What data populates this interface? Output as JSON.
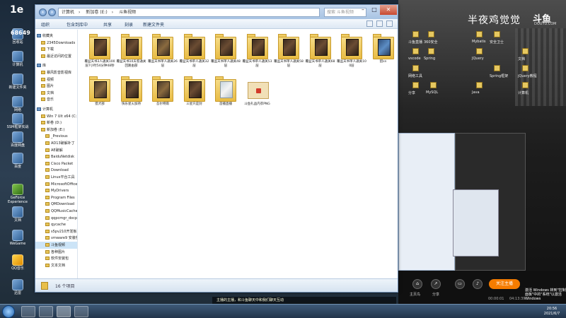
{
  "desktop": {
    "icons": [
      {
        "label": "回收站"
      },
      {
        "label": "计算机"
      },
      {
        "label": "新建文件夹"
      },
      {
        "label": "网络"
      },
      {
        "label": "SSM框架实战"
      },
      {
        "label": "百度网盘"
      },
      {
        "label": "百度"
      },
      {
        "label": "GeForce Experience"
      },
      {
        "label": "文档"
      },
      {
        "label": "WeGame"
      },
      {
        "label": "QQ音乐"
      },
      {
        "label": "迅雷"
      }
    ]
  },
  "overlay": {
    "brand": "1e",
    "viewer_count": "68649"
  },
  "explorer": {
    "address": [
      "计算机",
      "新加卷 (E:)",
      "斗鱼视频"
    ],
    "search_placeholder": "搜索 斗鱼视频",
    "toolbar": {
      "organize": "组织",
      "add_to_library": "包含到库中",
      "share": "共享",
      "burn": "刻录",
      "new_folder": "新建文件夹"
    },
    "sidebar": [
      {
        "label": "收藏夹",
        "type": "hdr"
      },
      {
        "label": "2345Downloads",
        "type": "item"
      },
      {
        "label": "下载",
        "type": "item"
      },
      {
        "label": "最近访问的位置",
        "type": "item"
      },
      {
        "label": "",
        "type": "gap"
      },
      {
        "label": "库",
        "type": "hdr"
      },
      {
        "label": "暴风影音影视库",
        "type": "item"
      },
      {
        "label": "视频",
        "type": "item"
      },
      {
        "label": "图片",
        "type": "item"
      },
      {
        "label": "文档",
        "type": "item"
      },
      {
        "label": "音乐",
        "type": "item"
      },
      {
        "label": "",
        "type": "gap"
      },
      {
        "label": "计算机",
        "type": "hdr"
      },
      {
        "label": "Win 7 Ult x64 (C:)",
        "type": "item"
      },
      {
        "label": "新卷 (D:)",
        "type": "item"
      },
      {
        "label": "新加卷 (E:)",
        "type": "item"
      },
      {
        "label": "_Previous",
        "type": "item"
      },
      {
        "label": "AD13破解补丁",
        "type": "item"
      },
      {
        "label": "AE破解",
        "type": "item"
      },
      {
        "label": "BaiduNetdisk",
        "type": "item"
      },
      {
        "label": "Cisco Packet",
        "type": "item"
      },
      {
        "label": "Download",
        "type": "item"
      },
      {
        "label": "Linux平台工具",
        "type": "item"
      },
      {
        "label": "MicrosoftOffice",
        "type": "item"
      },
      {
        "label": "MyDrivers",
        "type": "item"
      },
      {
        "label": "Program Files",
        "type": "item"
      },
      {
        "label": "QMDownload",
        "type": "item"
      },
      {
        "label": "QQMusicCache",
        "type": "item"
      },
      {
        "label": "qqpcmgr_docpro",
        "type": "item"
      },
      {
        "label": "qycache",
        "type": "item"
      },
      {
        "label": "s5pv210开发板",
        "type": "item"
      },
      {
        "label": "vmware9 安装包",
        "type": "item"
      },
      {
        "label": "斗鱼视频",
        "type": "sel"
      },
      {
        "label": "各种图片",
        "type": "item"
      },
      {
        "label": "软件安装包",
        "type": "item"
      },
      {
        "label": "文本文档",
        "type": "item"
      }
    ],
    "files": [
      {
        "label": "覆盆天书3人通关100层7小时54分钟48秒",
        "thumb": "dk"
      },
      {
        "label": "覆盆天书10天卷通关回路由部",
        "thumb": "dk"
      },
      {
        "label": "覆盆天书单人通关26层",
        "thumb": "bl"
      },
      {
        "label": "覆盆天书单人通关32层",
        "thumb": "dk"
      },
      {
        "label": "覆盆天书单人通关48层",
        "thumb": "dk"
      },
      {
        "label": "覆盆天书单人通关53层",
        "thumb": "dk"
      },
      {
        "label": "覆盆天书单人通关58层",
        "thumb": "dk"
      },
      {
        "label": "覆盆天书单人通关68层",
        "thumb": "dk"
      },
      {
        "label": "覆盆天书单人通关100层",
        "thumb": "dk"
      },
      {
        "label": "猎sn",
        "thumb": "blue"
      },
      {
        "label": "猎犬部",
        "thumb": "bl"
      },
      {
        "label": "快乐星火加持",
        "thumb": "dk"
      },
      {
        "label": "吾尔特雨",
        "thumb": "bl"
      },
      {
        "label": "三星只是封",
        "thumb": "dk"
      },
      {
        "label": "首播直播",
        "thumb": "lt"
      },
      {
        "label": "斗鱼礼品内衣PNG",
        "thumb": "png"
      }
    ],
    "status": "16 个项目"
  },
  "stream": {
    "title": "半夜鸡觉觉",
    "logo": "斗鱼",
    "logo_sub": "DOUYU.COM",
    "desk_labels": [
      "斗鱼直播",
      "360安全",
      "Mybatis",
      "安全卫士",
      "vscode",
      "Spring",
      "JQuery",
      "文档",
      "网络工具",
      "Spring框架",
      "jQuery教程",
      "分享",
      "MySQL",
      "Java",
      "计算机"
    ],
    "buttons": [
      {
        "label": "主页鸟",
        "glyph": "⌂"
      },
      {
        "label": "分享",
        "glyph": "↗"
      },
      {
        "label": "",
        "glyph": "▭"
      },
      {
        "label": "",
        "glyph": "♪"
      }
    ],
    "subscribe": "关注主播",
    "status_left": "00:00:01",
    "status_right": "04:13:39",
    "corner_note": "激活 Windows 转到\"控制面板\"中的\"系统\"以激活 Windows"
  },
  "chat_bar": "主播的主播，和斗鱼聊天中和我们聊天互动",
  "taskbar": {
    "clock_time": "20:56",
    "clock_date": "2021/6/7"
  }
}
